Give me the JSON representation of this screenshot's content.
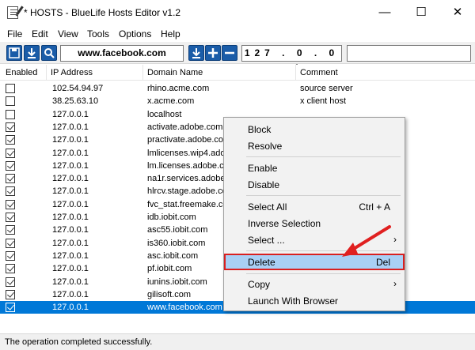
{
  "window": {
    "title": "* HOSTS - BlueLife Hosts Editor v1.2",
    "minimize": "—",
    "maximize": "☐",
    "close": "✕"
  },
  "menu": [
    "File",
    "Edit",
    "View",
    "Tools",
    "Options",
    "Help"
  ],
  "toolbar": {
    "domain_value": "www.facebook.com",
    "ip_value": "127 . 0 . 0 . 1",
    "comment_value": "",
    "icons": [
      "save-icon",
      "download-icon",
      "search-icon",
      "download-icon",
      "add-icon",
      "remove-icon"
    ]
  },
  "columns": [
    "Enabled",
    "IP Address",
    "Domain Name",
    "Comment"
  ],
  "rows": [
    {
      "enabled": false,
      "ip": "102.54.94.97",
      "domain": "rhino.acme.com",
      "comment": "source server"
    },
    {
      "enabled": false,
      "ip": "38.25.63.10",
      "domain": "x.acme.com",
      "comment": "x client host"
    },
    {
      "enabled": false,
      "ip": "127.0.0.1",
      "domain": "localhost",
      "comment": ""
    },
    {
      "enabled": true,
      "ip": "127.0.0.1",
      "domain": "activate.adobe.com",
      "comment": ""
    },
    {
      "enabled": true,
      "ip": "127.0.0.1",
      "domain": "practivate.adobe.com",
      "comment": ""
    },
    {
      "enabled": true,
      "ip": "127.0.0.1",
      "domain": "lmlicenses.wip4.adobe.com",
      "comment": ""
    },
    {
      "enabled": true,
      "ip": "127.0.0.1",
      "domain": "lm.licenses.adobe.com",
      "comment": ""
    },
    {
      "enabled": true,
      "ip": "127.0.0.1",
      "domain": "na1r.services.adobe.com",
      "comment": ""
    },
    {
      "enabled": true,
      "ip": "127.0.0.1",
      "domain": "hlrcv.stage.adobe.com",
      "comment": ""
    },
    {
      "enabled": true,
      "ip": "127.0.0.1",
      "domain": "fvc_stat.freemake.com",
      "comment": ""
    },
    {
      "enabled": true,
      "ip": "127.0.0.1",
      "domain": "idb.iobit.com",
      "comment": ""
    },
    {
      "enabled": true,
      "ip": "127.0.0.1",
      "domain": "asc55.iobit.com",
      "comment": ""
    },
    {
      "enabled": true,
      "ip": "127.0.0.1",
      "domain": "is360.iobit.com",
      "comment": ""
    },
    {
      "enabled": true,
      "ip": "127.0.0.1",
      "domain": "asc.iobit.com",
      "comment": ""
    },
    {
      "enabled": true,
      "ip": "127.0.0.1",
      "domain": "pf.iobit.com",
      "comment": ""
    },
    {
      "enabled": true,
      "ip": "127.0.0.1",
      "domain": "iunins.iobit.com",
      "comment": ""
    },
    {
      "enabled": true,
      "ip": "127.0.0.1",
      "domain": "gilisoft.com",
      "comment": ""
    },
    {
      "enabled": true,
      "ip": "127.0.0.1",
      "domain": "www.facebook.com",
      "comment": "",
      "selected": true
    }
  ],
  "context_menu": {
    "block": "Block",
    "resolve": "Resolve",
    "enable": "Enable",
    "disable": "Disable",
    "select_all": "Select All",
    "select_all_shortcut": "Ctrl + A",
    "inverse_selection": "Inverse Selection",
    "select": "Select ...",
    "delete": "Delete",
    "delete_shortcut": "Del",
    "copy": "Copy",
    "launch_browser": "Launch With Browser"
  },
  "status": "The operation completed successfully.",
  "colors": {
    "selection": "#0078d7",
    "highlight_border": "#d92020",
    "highlight_fill": "#a9d0f5",
    "toolbar_icon": "#1a5ca8"
  }
}
